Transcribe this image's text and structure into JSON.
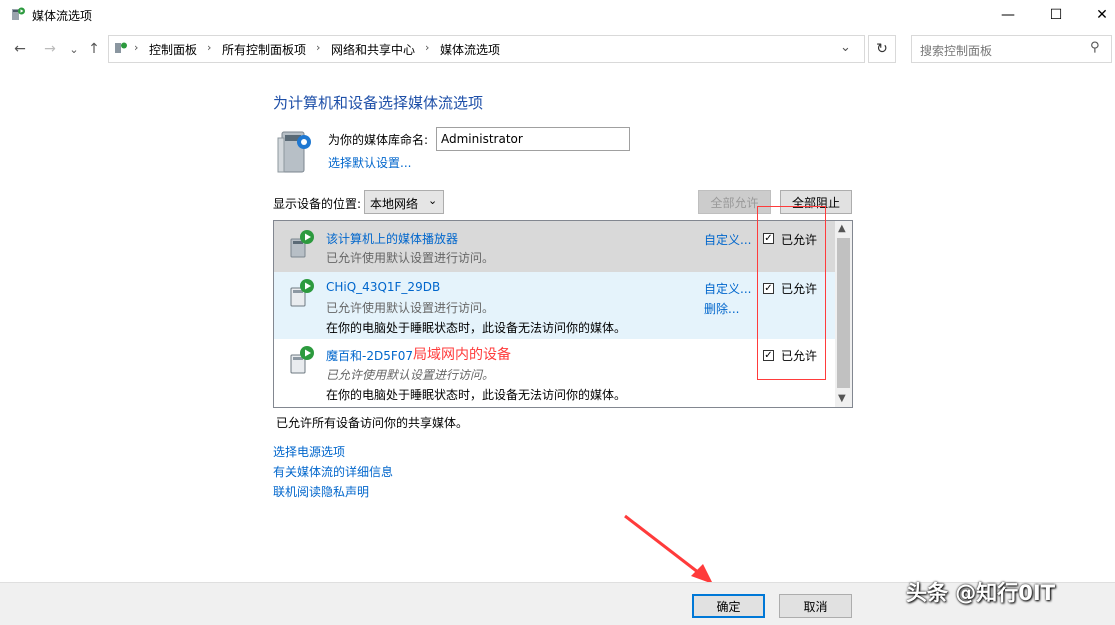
{
  "window": {
    "title": "媒体流选项",
    "minimize": "—",
    "maximize": "☐",
    "close": "✕"
  },
  "nav": {
    "back": "←",
    "forward": "→",
    "recent": "⌄",
    "up": "↑",
    "breadcrumbs": [
      "控制面板",
      "所有控制面板项",
      "网络和共享中心",
      "媒体流选项"
    ],
    "dropdown": "⌄",
    "refresh": "↻",
    "search_placeholder": "搜索控制面板",
    "search_icon": "⚲"
  },
  "main": {
    "heading": "为计算机和设备选择媒体流选项",
    "library_label": "为你的媒体库命名:",
    "library_name": "Administrator",
    "choose_defaults": "选择默认设置...",
    "show_devices_label": "显示设备的位置:",
    "location_value": "本地网络",
    "allow_all": "全部允许",
    "block_all": "全部阻止",
    "devices": [
      {
        "name": "该计算机上的媒体播放器",
        "status": "已允许使用默认设置进行访问。",
        "note": "",
        "actions": [
          "自定义..."
        ],
        "allowed_label": "已允许",
        "checked": true
      },
      {
        "name": "CHiQ_43Q1F_29DB",
        "status": "已允许使用默认设置进行访问。",
        "note": "在你的电脑处于睡眠状态时，此设备无法访问你的媒体。",
        "actions": [
          "自定义...",
          "删除..."
        ],
        "allowed_label": "已允许",
        "checked": true
      },
      {
        "name": "魔百和-2D5F07",
        "status": "已允许使用默认设置进行访问。",
        "note": "在你的电脑处于睡眠状态时，此设备无法访问你的媒体。",
        "actions": [],
        "allowed_label": "已允许",
        "checked": true
      }
    ],
    "annotation": "局域网内的设备",
    "summary": "已允许所有设备访问你的共享媒体。",
    "links": [
      "选择电源选项",
      "有关媒体流的详细信息",
      "联机阅读隐私声明"
    ]
  },
  "footer": {
    "ok": "确定",
    "cancel": "取消"
  },
  "watermark": "头条 @知行0IT",
  "colors": {
    "heading": "#1e4fa8",
    "link": "#0066cc",
    "selected_row": "#e5f3fb",
    "disabled_row": "#d9d9d9",
    "annotation": "#ff3b3b"
  }
}
